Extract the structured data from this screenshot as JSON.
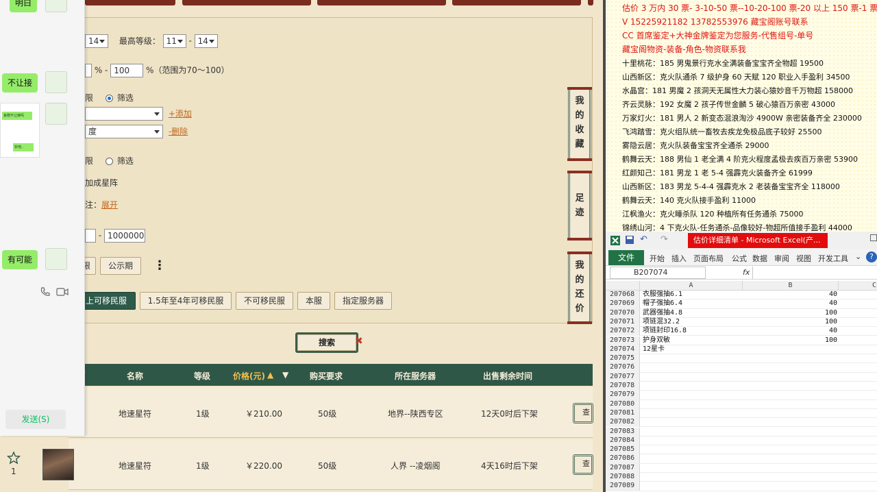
{
  "chat": {
    "bubbles": [
      "明白",
      "不让接",
      "有可能"
    ],
    "mini_text_1": "妄赠不让接吗",
    "mini_text_2": "钞他..",
    "send_label": "发送(S)"
  },
  "filter": {
    "level_from": "14",
    "max_level_label": "最高等级：",
    "max_level_a": "11",
    "max_level_sep": "-",
    "max_level_b": "14",
    "pct_sep": "% -",
    "pct_value": "100",
    "pct_hint": "%（范围为70～100）",
    "filter_label_1": "筛选",
    "add_link": "+添加",
    "select_2_text": "度",
    "delete_link": "-删除",
    "filter_label_2": "筛选",
    "partial_1": "限",
    "partial_2": "限",
    "star_bonus": "加成星阵",
    "expand_prefix": "注：",
    "expand_link": "展开",
    "price_sep": "-",
    "price_max": "1000000",
    "btn_period_partial": "限",
    "btn_public": "公示期",
    "more_icon": "⋮",
    "migration_buttons": [
      "上可移民服",
      "1.5年至4年可移民服",
      "不可移民服",
      "本服",
      "指定服务器"
    ]
  },
  "side_tabs": {
    "favorites": [
      "我",
      "的",
      "收",
      "藏"
    ],
    "footprint": [
      "足",
      "迹"
    ],
    "bargain": [
      "我",
      "的",
      "还",
      "价"
    ]
  },
  "search": {
    "label": "搜索",
    "clear": "✖"
  },
  "table": {
    "headers": [
      "名称",
      "等级",
      "价格(元)",
      "购买要求",
      "所在服务器",
      "出售剩余时间"
    ],
    "partial_header": "/",
    "rows": [
      {
        "name": "地速星符",
        "level": "1级",
        "price": "￥210.00",
        "req": "50级",
        "server": "地界--陕西专区",
        "time": "12天0时后下架",
        "btn": "查"
      },
      {
        "name": "地速星符",
        "level": "1级",
        "price": "￥220.00",
        "req": "50级",
        "server": "人界 --凌烟阁",
        "time": "4天16时后下架",
        "btn": "查"
      }
    ],
    "fav_count": "1"
  },
  "notes": {
    "red_lines": [
      "估价 3 万内 30 票- 3-10-50 票--10-20-100 票-20 以上 150 票-1 票 1 元",
      "V 15225921182      13782553976    藏宝阁账号联系",
      "CC 首席鉴定+大神金牌鉴定为您服务-代售组号-单号",
      "藏宝阁物资-装备-角色-物资联系我"
    ],
    "lines": [
      "十里桃花：185 男鬼景行克水全满装备宝宝齐全物超 19500",
      "山西新区：克火队通杀 7 级护身 60 天赋 120 职业入手盈利 34500",
      "水晶宫：181 男魔 2 孩洞天无属性大力装心猿妙音千万物超 158000",
      "齐云灵脉：192 女魔 2 孩子传世金麟 5 破心猿百万亲密 43000",
      "万家灯火：181 男人 2 新变态混浪淘沙 4900W 亲密装备齐全 230000",
      "飞鸿踏雪：克火组队统一畜牧去疾龙免极品底子较好 25500",
      "雾隐云居：克火队装备宝宝齐全通杀 29000",
      "鹤舞云天：188 男仙 1 老全满 4 阶克火程度孟极去疾百万亲密 53900",
      "红颜知己：181 男龙 1 老 5-4 强霹克火装备齐全 61999",
      "山西新区：183 男龙 5-4-4 强霹克水 2 老装备宝宝齐全 118000",
      "鹤舞云天：140 克火队接手盈利 11000",
      "江枫渔火：克火睡杀队 120 种植所有任务通杀 75000",
      "锦绣山河：4 下克火队-任务通杀-品像较好-物超所值接手盈利 44000"
    ]
  },
  "excel": {
    "title": "估价详细清单 - Microsoft Excel(产...",
    "tabs": [
      "开始",
      "插入",
      "页面布局",
      "公式",
      "数据",
      "审阅",
      "视图",
      "开发工具"
    ],
    "file_tab": "文件",
    "name_box": "B207074",
    "fx": "fx",
    "col_headers": [
      "A",
      "B",
      "C"
    ],
    "rows": [
      {
        "n": "207068",
        "a": "衣服强抽6.1",
        "b": "40"
      },
      {
        "n": "207069",
        "a": "帽子强抽6.4",
        "b": "40"
      },
      {
        "n": "207070",
        "a": "武器强抽4.8",
        "b": "100"
      },
      {
        "n": "207071",
        "a": "项链混32.2",
        "b": "100"
      },
      {
        "n": "207072",
        "a": "项链封印16.8",
        "b": "40"
      },
      {
        "n": "207073",
        "a": "护身双敏",
        "b": "100"
      },
      {
        "n": "207074",
        "a": "12星卡",
        "b": ""
      },
      {
        "n": "207075",
        "a": "",
        "b": ""
      },
      {
        "n": "207076",
        "a": "",
        "b": ""
      },
      {
        "n": "207077",
        "a": "",
        "b": ""
      },
      {
        "n": "207078",
        "a": "",
        "b": ""
      },
      {
        "n": "207079",
        "a": "",
        "b": ""
      },
      {
        "n": "207080",
        "a": "",
        "b": ""
      },
      {
        "n": "207081",
        "a": "",
        "b": ""
      },
      {
        "n": "207082",
        "a": "",
        "b": ""
      },
      {
        "n": "207083",
        "a": "",
        "b": ""
      },
      {
        "n": "207084",
        "a": "",
        "b": ""
      },
      {
        "n": "207085",
        "a": "",
        "b": ""
      },
      {
        "n": "207086",
        "a": "",
        "b": ""
      },
      {
        "n": "207087",
        "a": "",
        "b": ""
      },
      {
        "n": "207088",
        "a": "",
        "b": ""
      },
      {
        "n": "207089",
        "a": "",
        "b": ""
      }
    ]
  },
  "colors": {
    "accent_green": "#2f5747",
    "excel_green": "#217346",
    "notes_red": "#e0150f",
    "chat_green": "#95ec69"
  }
}
